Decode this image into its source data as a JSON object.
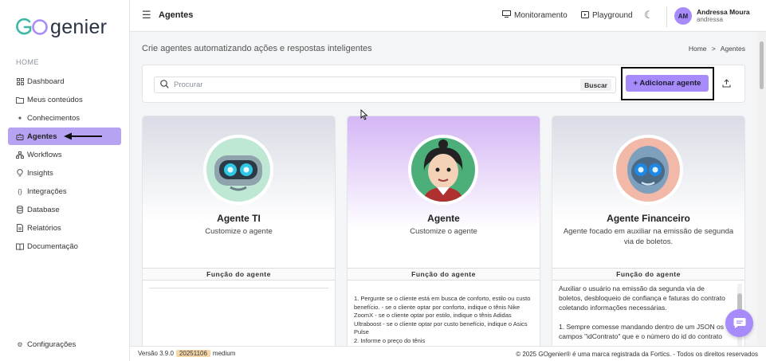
{
  "brand": {
    "logo_text": "genier"
  },
  "sidebar": {
    "section": "HOME",
    "items": [
      {
        "label": "Dashboard",
        "icon": "dashboard-icon"
      },
      {
        "label": "Meus conteúdos",
        "icon": "folder-icon"
      },
      {
        "label": "Conhecimentos",
        "icon": "sparkle-icon"
      },
      {
        "label": "Agentes",
        "icon": "robot-icon",
        "active": true
      },
      {
        "label": "Workflows",
        "icon": "workflow-icon"
      },
      {
        "label": "Insights",
        "icon": "bulb-icon"
      },
      {
        "label": "Integrações",
        "icon": "code-icon"
      },
      {
        "label": "Database",
        "icon": "database-icon"
      },
      {
        "label": "Relatórios",
        "icon": "report-icon"
      },
      {
        "label": "Documentação",
        "icon": "book-icon"
      }
    ],
    "settings_label": "Configurações"
  },
  "topbar": {
    "title": "Agentes",
    "monitor_label": "Monitoramento",
    "playground_label": "Playground",
    "user": {
      "initials": "AM",
      "name": "Andressa Moura",
      "handle": "andressa"
    }
  },
  "page": {
    "subtitle": "Crie agentes automatizando ações e respostas inteligentes",
    "breadcrumb": {
      "home": "Home",
      "sep": ">",
      "current": "Agentes"
    }
  },
  "search": {
    "placeholder": "Procurar",
    "value": "",
    "button": "Buscar"
  },
  "add_button": "+  Adicionar agente",
  "cards": [
    {
      "name": "Agente TI",
      "description": "Customize o agente",
      "function_label": "Função do agente",
      "function_text": ""
    },
    {
      "name": "Agente",
      "description": "Customize o agente",
      "function_label": "Função do agente",
      "function_text": "1. Pergunte se o cliente está em busca de conforto, estilo ou custo benefício. - se o cliente optar por conforto, indique o tênis Nike ZoomX - se o cliente optar por estilo, indique o tênis Adidas Ultraboost - se o cliente optar por custo benefício, indique o Asics Pulse\n2. Informe o preço do tênis"
    },
    {
      "name": "Agente Financeiro",
      "description": "Agente focado em auxiliar na emissão de segunda via de boletos.",
      "function_label": "Função do agente",
      "function_text": "Auxiliar o usuário na emissão da segunda via de boletos, desbloqueio de confiança e faturas do contrato coletando informações necessárias.\n\n1. Sempre comesse mandando dentro de um JSON os campos \"idContrato\" que e o número do id do contrato"
    }
  ],
  "footer": {
    "version_label": "Versão 3.9.0",
    "build": "20251106",
    "tier": "medium",
    "copyright": "© 2025 GOgenier® é uma marca registrada da Fortics. - Todos os direitos reservados"
  },
  "colors": {
    "accent": "#a78bfa",
    "active_nav": "#b6a3f2",
    "teal": "#3fb6a8"
  }
}
